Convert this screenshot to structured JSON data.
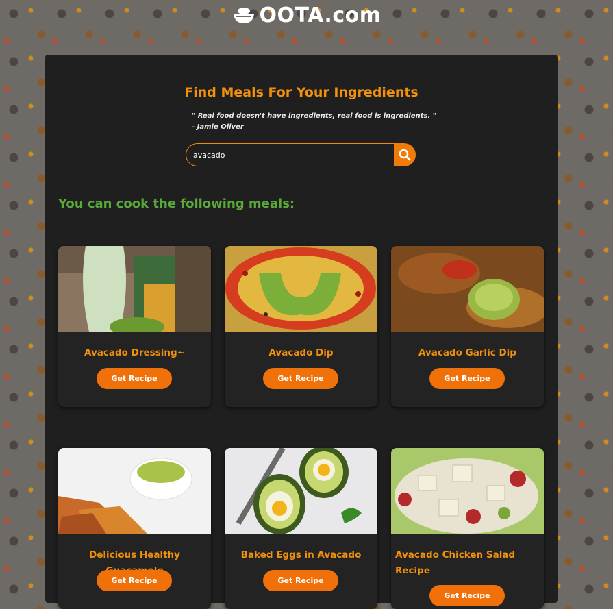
{
  "header": {
    "logo_text": "OOTA.com"
  },
  "search_section": {
    "title": "Find Meals For Your Ingredients",
    "quote_line": "\" Real food doesn't have ingredients, real food is ingredients. \"",
    "quote_author": "- Jamie Oliver",
    "search_value": "avacado",
    "search_icon": "search-icon"
  },
  "results": {
    "heading": "You can cook the following meals:",
    "button_label": "Get Recipe",
    "meals": [
      {
        "title": "Avacado Dressing~"
      },
      {
        "title": "Avacado Dip"
      },
      {
        "title": "Avacado Garlic Dip"
      },
      {
        "title": "Delicious Healthy Guacamole"
      },
      {
        "title": "Baked Eggs in Avacado"
      },
      {
        "title": "Avacado Chicken Salad Recipe"
      }
    ]
  },
  "colors": {
    "accent_orange": "#f0700a",
    "title_orange": "#f0900c",
    "heading_green": "#5aa83a",
    "panel_bg": "#1f1f1f"
  }
}
